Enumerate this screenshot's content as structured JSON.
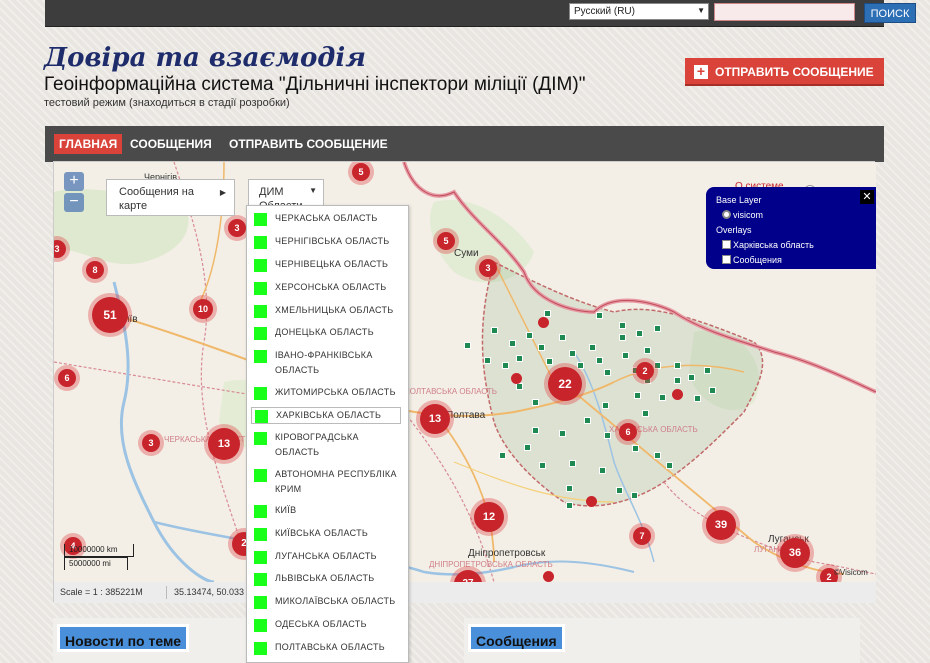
{
  "topbar": {
    "language": "Русский (RU)",
    "search_placeholder": "",
    "search_button": "ПОИСК"
  },
  "header": {
    "title": "Довіра та взаємодія",
    "subtitle": "Геоінформаційна система \"Дільничні інспектори міліції (ДІМ)\"",
    "note": "тестовий режим (знаходиться в стадії розробки)",
    "send_button": "ОТПРАВИТЬ СООБЩЕНИЕ"
  },
  "nav": {
    "items": [
      "ГЛАВНАЯ",
      "СООБЩЕНИЯ",
      "ОТПРАВИТЬ СООБЩЕНИЕ"
    ]
  },
  "map": {
    "messages_dropdown": "Сообщения на карте",
    "dim_dropdown": "ДИМ Области",
    "about_link": "О системе",
    "help": "?",
    "layers": {
      "base_layer_title": "Base Layer",
      "base_layer": "visicom",
      "overlays_title": "Overlays",
      "overlay_1": "Харківська область",
      "overlay_2": "Сообщения"
    },
    "cities": [
      "Суми",
      "Полтава",
      "Дніпропетровськ",
      "Луганськ",
      "Київ",
      "Чернігів"
    ],
    "clusters": [
      "51",
      "22",
      "13",
      "13",
      "12",
      "39",
      "36",
      "10",
      "8",
      "6",
      "5",
      "5",
      "3",
      "3",
      "3",
      "2",
      "2",
      "6",
      "7",
      "4",
      "2",
      "27",
      "3"
    ],
    "scale_text": [
      "10000000 km",
      "5000000 mi"
    ],
    "copyright": "©Visicom",
    "status_scale": "Scale = 1 : 385221M",
    "status_coords": "35.13474, 50.033",
    "region_labels": [
      "ХАРКІВСЬКА ОБЛАСТЬ",
      "ПОЛТАВСЬКА ОБЛАСТЬ",
      "ЧЕРКАСЬКА ОБЛАСТЬ",
      "ДНІПРОПЕТРОВСЬКА ОБЛАСТЬ",
      "ЛУГАНСЬКА"
    ]
  },
  "regions": [
    "ЧЕРКАСЬКА ОБЛАСТЬ",
    "ЧЕРНІГІВСЬКА ОБЛАСТЬ",
    "ЧЕРНІВЕЦЬКА ОБЛАСТЬ",
    "ХЕРСОНСЬКА ОБЛАСТЬ",
    "ХМЕЛЬНИЦЬКА ОБЛАСТЬ",
    "ДОНЕЦЬКА ОБЛАСТЬ",
    "ІВАНО-ФРАНКІВСЬКА ОБЛАСТЬ",
    "ЖИТОМИРСЬКА ОБЛАСТЬ",
    "ХАРКІВСЬКА ОБЛАСТЬ",
    "КІРОВОГРАДСЬКА ОБЛАСТЬ",
    "АВТОНОМНА РЕСПУБЛІКА КРИМ",
    "КИЇВ",
    "КИЇВСЬКА ОБЛАСТЬ",
    "ЛУГАНСЬКА ОБЛАСТЬ",
    "ЛЬВІВСЬКА ОБЛАСТЬ",
    "МИКОЛАЇВСЬКА ОБЛАСТЬ",
    "ОДЕСЬКА ОБЛАСТЬ",
    "ПОЛТАВСЬКА ОБЛАСТЬ"
  ],
  "panels": {
    "news": "Новости по теме",
    "messages": "Сообщения"
  },
  "colors": {
    "accent": "#d9433a",
    "cluster": "#c8242b",
    "layers_panel": "#00008b",
    "region_marker": "#1aff1a",
    "house_marker": "#1e8a52"
  }
}
